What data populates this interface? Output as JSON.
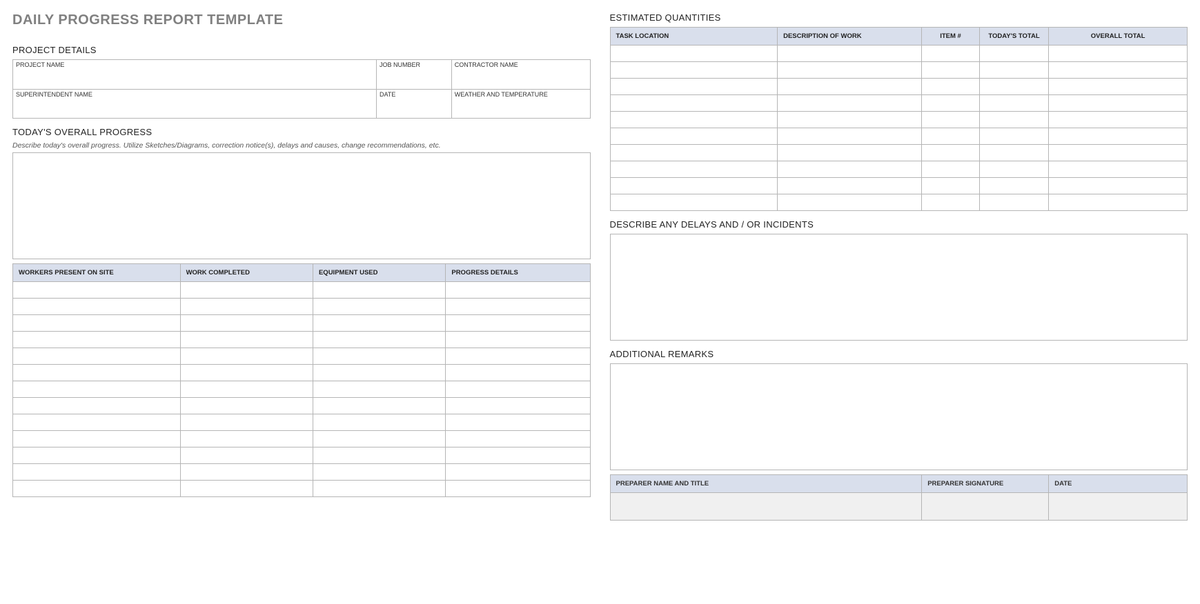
{
  "title": "DAILY PROGRESS REPORT TEMPLATE",
  "sections": {
    "project_details": {
      "heading": "PROJECT DETAILS",
      "labels": {
        "project_name": "PROJECT NAME",
        "job_number": "JOB NUMBER",
        "contractor_name": "CONTRACTOR NAME",
        "superintendent_name": "SUPERINTENDENT NAME",
        "date": "DATE",
        "weather_temp": "WEATHER AND TEMPERATURE"
      }
    },
    "overall_progress": {
      "heading": "TODAY'S OVERALL PROGRESS",
      "instruction": "Describe today's overall progress.  Utilize Sketches/Diagrams, correction notice(s), delays and causes, change recommendations, etc."
    },
    "work_table": {
      "headers": {
        "workers": "WORKERS PRESENT ON SITE",
        "work_completed": "WORK COMPLETED",
        "equipment": "EQUIPMENT USED",
        "progress": "PROGRESS DETAILS"
      },
      "row_count": 13
    },
    "estimated_quantities": {
      "heading": "ESTIMATED QUANTITIES",
      "headers": {
        "task_location": "TASK LOCATION",
        "description": "DESCRIPTION OF WORK",
        "item_no": "ITEM #",
        "todays_total": "TODAY'S TOTAL",
        "overall_total": "OVERALL TOTAL"
      },
      "row_count": 10
    },
    "delays": {
      "heading": "DESCRIBE ANY DELAYS AND / OR INCIDENTS"
    },
    "remarks": {
      "heading": "ADDITIONAL REMARKS"
    },
    "signoff": {
      "headers": {
        "preparer": "PREPARER NAME AND TITLE",
        "signature": "PREPARER SIGNATURE",
        "date": "DATE"
      }
    }
  }
}
